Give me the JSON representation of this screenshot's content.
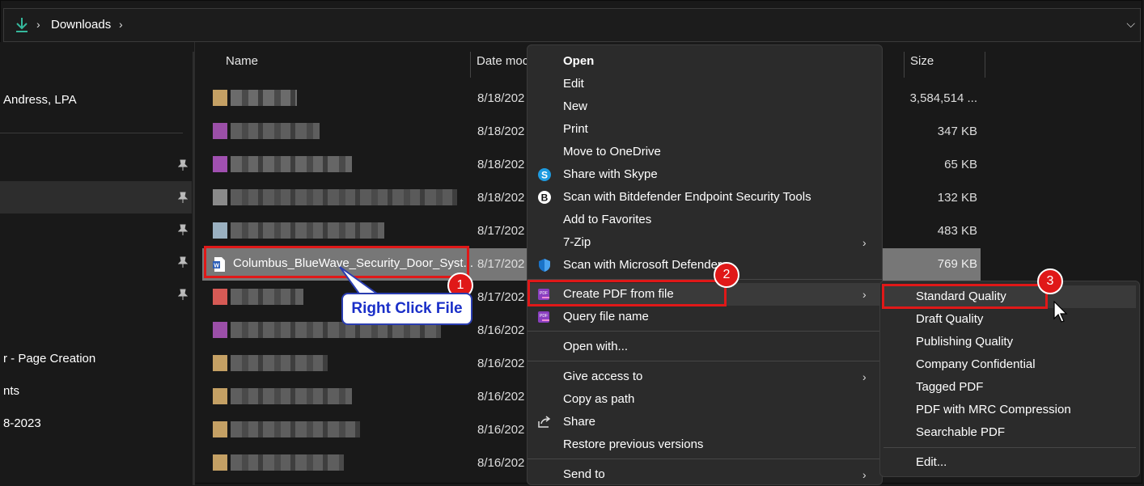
{
  "breadcrumb": {
    "folder": "Downloads"
  },
  "sidebar": {
    "items": [
      {
        "label": "Andress, LPA",
        "pinned": false,
        "selected": false
      },
      {
        "label": "",
        "pinned": true,
        "selected": false
      },
      {
        "label": "",
        "pinned": true,
        "selected": true
      },
      {
        "label": "",
        "pinned": true,
        "selected": false
      },
      {
        "label": "",
        "pinned": true,
        "selected": false
      },
      {
        "label": "",
        "pinned": true,
        "selected": false
      },
      {
        "label": "r - Page Creation",
        "pinned": false,
        "selected": false
      },
      {
        "label": "nts",
        "pinned": false,
        "selected": false
      },
      {
        "label": "8-2023",
        "pinned": false,
        "selected": false
      }
    ]
  },
  "columns": {
    "name": "Name",
    "date": "Date moc",
    "size": "Size"
  },
  "files": [
    {
      "date": "8/18/202",
      "size": "3,584,514 ...",
      "colors": [
        "#c4a064",
        "#6b6b6b"
      ]
    },
    {
      "date": "8/18/202",
      "size": "347 KB",
      "colors": [
        "#9b4fa8",
        "#5e5e5e"
      ]
    },
    {
      "date": "8/18/202",
      "size": "65 KB",
      "colors": [
        "#a050b0",
        "#666666"
      ]
    },
    {
      "date": "8/18/202",
      "size": "132 KB",
      "colors": [
        "#8a8a8a",
        "#5a5a5a"
      ]
    },
    {
      "date": "8/17/202",
      "size": "483 KB",
      "colors": [
        "#9ab0c0",
        "#606060"
      ]
    },
    {
      "date": "8/17/202",
      "size": "769 KB",
      "name": "Columbus_BlueWave_Security_Door_Syst...",
      "selected": true
    },
    {
      "date": "8/17/202",
      "size": "",
      "colors": [
        "#d65a55",
        "#606060"
      ]
    },
    {
      "date": "8/16/202",
      "size": "",
      "colors": [
        "#9b4fa8",
        "#5e5e5e"
      ]
    },
    {
      "date": "8/16/202",
      "size": "",
      "colors": [
        "#c4a064",
        "#5e5e5e"
      ]
    },
    {
      "date": "8/16/202",
      "size": "",
      "colors": [
        "#c4a064",
        "#5e5e5e"
      ]
    },
    {
      "date": "8/16/202",
      "size": "",
      "colors": [
        "#c4a064",
        "#5e5e5e"
      ]
    },
    {
      "date": "8/16/202",
      "size": "",
      "colors": [
        "#c4a064",
        "#5e5e5e"
      ]
    }
  ],
  "context_menu": {
    "open": "Open",
    "edit": "Edit",
    "new": "New",
    "print": "Print",
    "onedrive": "Move to OneDrive",
    "skype": "Share with Skype",
    "bitdefender": "Scan with Bitdefender Endpoint Security Tools",
    "favorites": "Add to Favorites",
    "zip": "7-Zip",
    "defender": "Scan with Microsoft Defender...",
    "create_pdf": "Create PDF from file",
    "query": "Query file name",
    "open_with": "Open with...",
    "give_access": "Give access to",
    "copy_path": "Copy as path",
    "share": "Share",
    "restore": "Restore previous versions",
    "send_to": "Send to"
  },
  "submenu": {
    "items": [
      "Standard Quality",
      "Draft Quality",
      "Publishing Quality",
      "Company Confidential",
      "Tagged PDF",
      "PDF with MRC Compression",
      "Searchable PDF"
    ],
    "edit": "Edit..."
  },
  "annotations": {
    "callout": "Right Click File",
    "step1": "1",
    "step2": "2",
    "step3": "3",
    "color": "#e01818"
  },
  "icons": {
    "address": "download-arrow-icon",
    "pin": "pin-icon",
    "skype": "skype-icon",
    "bitdefender": "bitdefender-icon",
    "defender": "defender-shield-icon",
    "pdf": "pdf-create-icon",
    "share": "share-icon",
    "word": "word-document-icon"
  }
}
